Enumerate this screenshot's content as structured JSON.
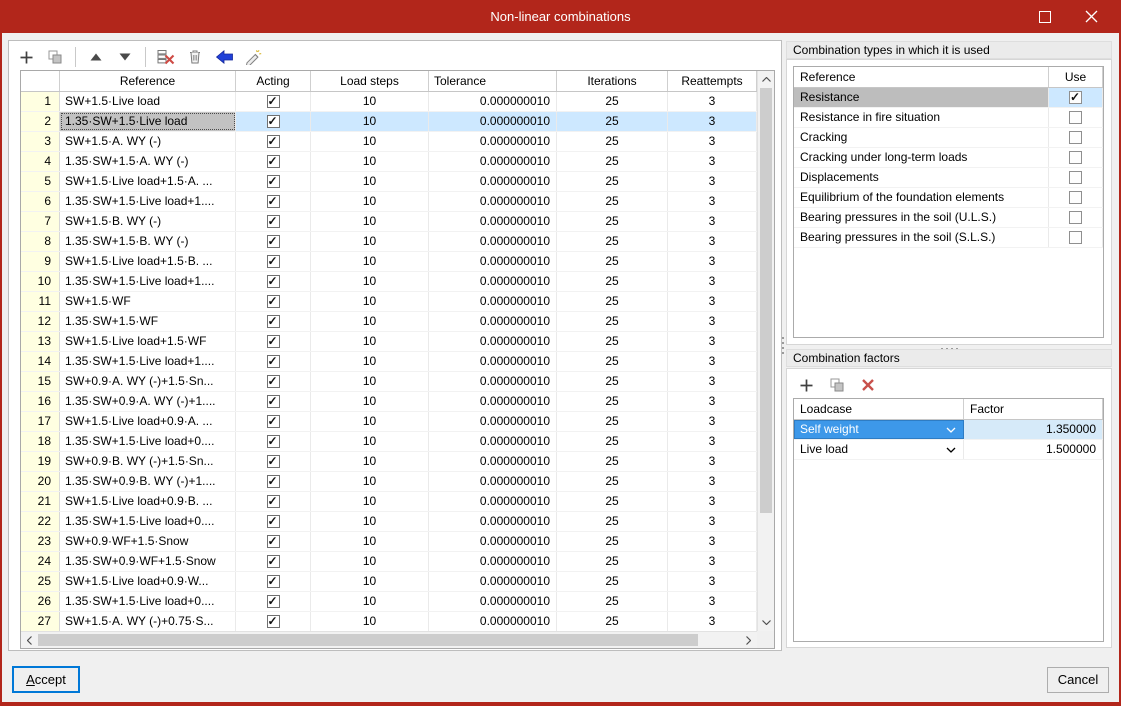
{
  "window": {
    "title": "Non-linear combinations"
  },
  "colors": {
    "titlebar": "#B2261B",
    "selected_row": "#CDE8FF",
    "active_cell": "#C2C2C2",
    "row_number_bg": "#FFFFE1",
    "selected_type_bg": "#BDBDBD",
    "loadcase_selected_bg": "#3D98E9",
    "factor_selected_bg": "#D6EAF9",
    "focus_border": "#0078D7",
    "undo_arrow_blue": "#2040D8",
    "delete_red": "#C8504B"
  },
  "main_table": {
    "toolbar_icons": [
      "add",
      "copy",
      "move-up",
      "move-down",
      "delete-rows",
      "trash",
      "undo",
      "format-clean"
    ],
    "columns": {
      "number": "",
      "reference": "Reference",
      "acting": "Acting",
      "load_steps": "Load steps",
      "tolerance": "Tolerance",
      "iterations": "Iterations",
      "reattempts": "Reattempts"
    },
    "rows": [
      {
        "num": "1",
        "reference": "SW+1.5·Live load",
        "acting": true,
        "load_steps": "10",
        "tolerance": "0.000000010",
        "iterations": "25",
        "reattempts": "3"
      },
      {
        "num": "2",
        "reference": "1.35·SW+1.5·Live load",
        "acting": true,
        "load_steps": "10",
        "tolerance": "0.000000010",
        "iterations": "25",
        "reattempts": "3",
        "selected": true
      },
      {
        "num": "3",
        "reference": "SW+1.5·A. WY (-)",
        "acting": true,
        "load_steps": "10",
        "tolerance": "0.000000010",
        "iterations": "25",
        "reattempts": "3"
      },
      {
        "num": "4",
        "reference": "1.35·SW+1.5·A. WY (-)",
        "acting": true,
        "load_steps": "10",
        "tolerance": "0.000000010",
        "iterations": "25",
        "reattempts": "3"
      },
      {
        "num": "5",
        "reference": "SW+1.5·Live load+1.5·A. ...",
        "acting": true,
        "load_steps": "10",
        "tolerance": "0.000000010",
        "iterations": "25",
        "reattempts": "3"
      },
      {
        "num": "6",
        "reference": "1.35·SW+1.5·Live load+1....",
        "acting": true,
        "load_steps": "10",
        "tolerance": "0.000000010",
        "iterations": "25",
        "reattempts": "3"
      },
      {
        "num": "7",
        "reference": "SW+1.5·B. WY (-)",
        "acting": true,
        "load_steps": "10",
        "tolerance": "0.000000010",
        "iterations": "25",
        "reattempts": "3"
      },
      {
        "num": "8",
        "reference": "1.35·SW+1.5·B. WY (-)",
        "acting": true,
        "load_steps": "10",
        "tolerance": "0.000000010",
        "iterations": "25",
        "reattempts": "3"
      },
      {
        "num": "9",
        "reference": "SW+1.5·Live load+1.5·B. ...",
        "acting": true,
        "load_steps": "10",
        "tolerance": "0.000000010",
        "iterations": "25",
        "reattempts": "3"
      },
      {
        "num": "10",
        "reference": "1.35·SW+1.5·Live load+1....",
        "acting": true,
        "load_steps": "10",
        "tolerance": "0.000000010",
        "iterations": "25",
        "reattempts": "3"
      },
      {
        "num": "11",
        "reference": "SW+1.5·WF",
        "acting": true,
        "load_steps": "10",
        "tolerance": "0.000000010",
        "iterations": "25",
        "reattempts": "3"
      },
      {
        "num": "12",
        "reference": "1.35·SW+1.5·WF",
        "acting": true,
        "load_steps": "10",
        "tolerance": "0.000000010",
        "iterations": "25",
        "reattempts": "3"
      },
      {
        "num": "13",
        "reference": "SW+1.5·Live load+1.5·WF",
        "acting": true,
        "load_steps": "10",
        "tolerance": "0.000000010",
        "iterations": "25",
        "reattempts": "3"
      },
      {
        "num": "14",
        "reference": "1.35·SW+1.5·Live load+1....",
        "acting": true,
        "load_steps": "10",
        "tolerance": "0.000000010",
        "iterations": "25",
        "reattempts": "3"
      },
      {
        "num": "15",
        "reference": "SW+0.9·A. WY (-)+1.5·Sn...",
        "acting": true,
        "load_steps": "10",
        "tolerance": "0.000000010",
        "iterations": "25",
        "reattempts": "3"
      },
      {
        "num": "16",
        "reference": "1.35·SW+0.9·A. WY (-)+1....",
        "acting": true,
        "load_steps": "10",
        "tolerance": "0.000000010",
        "iterations": "25",
        "reattempts": "3"
      },
      {
        "num": "17",
        "reference": "SW+1.5·Live load+0.9·A. ...",
        "acting": true,
        "load_steps": "10",
        "tolerance": "0.000000010",
        "iterations": "25",
        "reattempts": "3"
      },
      {
        "num": "18",
        "reference": "1.35·SW+1.5·Live load+0....",
        "acting": true,
        "load_steps": "10",
        "tolerance": "0.000000010",
        "iterations": "25",
        "reattempts": "3"
      },
      {
        "num": "19",
        "reference": "SW+0.9·B. WY (-)+1.5·Sn...",
        "acting": true,
        "load_steps": "10",
        "tolerance": "0.000000010",
        "iterations": "25",
        "reattempts": "3"
      },
      {
        "num": "20",
        "reference": "1.35·SW+0.9·B. WY (-)+1....",
        "acting": true,
        "load_steps": "10",
        "tolerance": "0.000000010",
        "iterations": "25",
        "reattempts": "3"
      },
      {
        "num": "21",
        "reference": "SW+1.5·Live load+0.9·B. ...",
        "acting": true,
        "load_steps": "10",
        "tolerance": "0.000000010",
        "iterations": "25",
        "reattempts": "3"
      },
      {
        "num": "22",
        "reference": "1.35·SW+1.5·Live load+0....",
        "acting": true,
        "load_steps": "10",
        "tolerance": "0.000000010",
        "iterations": "25",
        "reattempts": "3"
      },
      {
        "num": "23",
        "reference": "SW+0.9·WF+1.5·Snow",
        "acting": true,
        "load_steps": "10",
        "tolerance": "0.000000010",
        "iterations": "25",
        "reattempts": "3"
      },
      {
        "num": "24",
        "reference": "1.35·SW+0.9·WF+1.5·Snow",
        "acting": true,
        "load_steps": "10",
        "tolerance": "0.000000010",
        "iterations": "25",
        "reattempts": "3"
      },
      {
        "num": "25",
        "reference": "SW+1.5·Live load+0.9·W...",
        "acting": true,
        "load_steps": "10",
        "tolerance": "0.000000010",
        "iterations": "25",
        "reattempts": "3"
      },
      {
        "num": "26",
        "reference": "1.35·SW+1.5·Live load+0....",
        "acting": true,
        "load_steps": "10",
        "tolerance": "0.000000010",
        "iterations": "25",
        "reattempts": "3"
      },
      {
        "num": "27",
        "reference": "SW+1.5·A. WY (-)+0.75·S...",
        "acting": true,
        "load_steps": "10",
        "tolerance": "0.000000010",
        "iterations": "25",
        "reattempts": "3"
      }
    ]
  },
  "combination_types": {
    "title": "Combination types in which it is used",
    "columns": {
      "reference": "Reference",
      "use": "Use"
    },
    "rows": [
      {
        "reference": "Resistance",
        "use": true,
        "selected": true
      },
      {
        "reference": "Resistance in fire situation",
        "use": false
      },
      {
        "reference": "Cracking",
        "use": false
      },
      {
        "reference": "Cracking under long-term loads",
        "use": false
      },
      {
        "reference": "Displacements",
        "use": false
      },
      {
        "reference": "Equilibrium of the foundation elements",
        "use": false
      },
      {
        "reference": "Bearing pressures in the soil (U.L.S.)",
        "use": false
      },
      {
        "reference": "Bearing pressures in the soil (S.L.S.)",
        "use": false
      }
    ]
  },
  "combination_factors": {
    "title": "Combination factors",
    "toolbar_icons": [
      "add",
      "copy",
      "delete"
    ],
    "columns": {
      "loadcase": "Loadcase",
      "factor": "Factor"
    },
    "rows": [
      {
        "loadcase": "Self weight",
        "factor": "1.350000",
        "selected": true
      },
      {
        "loadcase": "Live load",
        "factor": "1.500000"
      }
    ]
  },
  "footer": {
    "accept": "Accept",
    "cancel": "Cancel"
  }
}
